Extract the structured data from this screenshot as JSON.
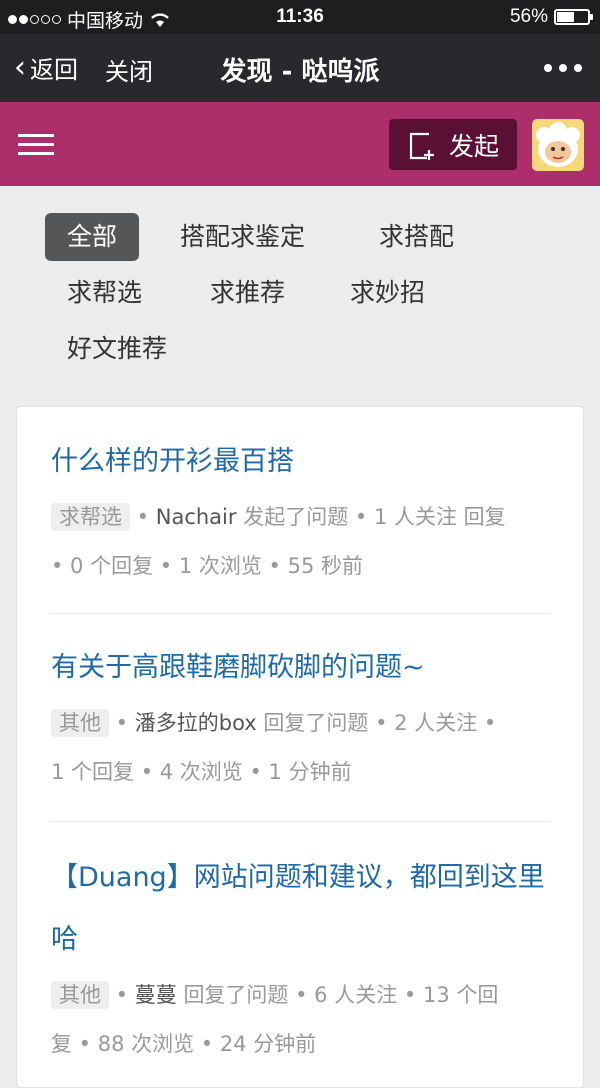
{
  "status": {
    "carrier": "中国移动",
    "time": "11:36",
    "battery": "56%",
    "battery_level": 0.56
  },
  "nav": {
    "back_label": "返回",
    "close_label": "关闭",
    "title": "发现 - 哒呜派"
  },
  "header": {
    "launch_label": "发起"
  },
  "filters": [
    "全部",
    "搭配求鉴定",
    "求搭配",
    "求帮选",
    "求推荐",
    "求妙招",
    "好文推荐"
  ],
  "questions": [
    {
      "title": "什么样的开衫最百搭",
      "tag": "求帮选",
      "user": "Nachair",
      "action": "发起了问题",
      "stats_line1": "• 1 人关注  回复",
      "stats_line2": "• 0 个回复 • 1 次浏览 • 55 秒前"
    },
    {
      "title": "有关于高跟鞋磨脚砍脚的问题~",
      "tag": "其他",
      "user": "潘多拉的box",
      "action": "回复了问题",
      "stats_line1": "• 2 人关注 •",
      "stats_line2": "1 个回复 • 4 次浏览 • 1 分钟前"
    },
    {
      "title": "【Duang】网站问题和建议，都回到这里哈",
      "tag": "其他",
      "user": "蔓蔓",
      "action": "回复了问题",
      "stats_line1": "• 6 人关注 • 13 个回",
      "stats_line2": "复 • 88 次浏览 • 24 分钟前"
    }
  ],
  "colors": {
    "accent": "#ac2f6c",
    "link": "#1f6aa5",
    "navbar": "#29282c"
  }
}
